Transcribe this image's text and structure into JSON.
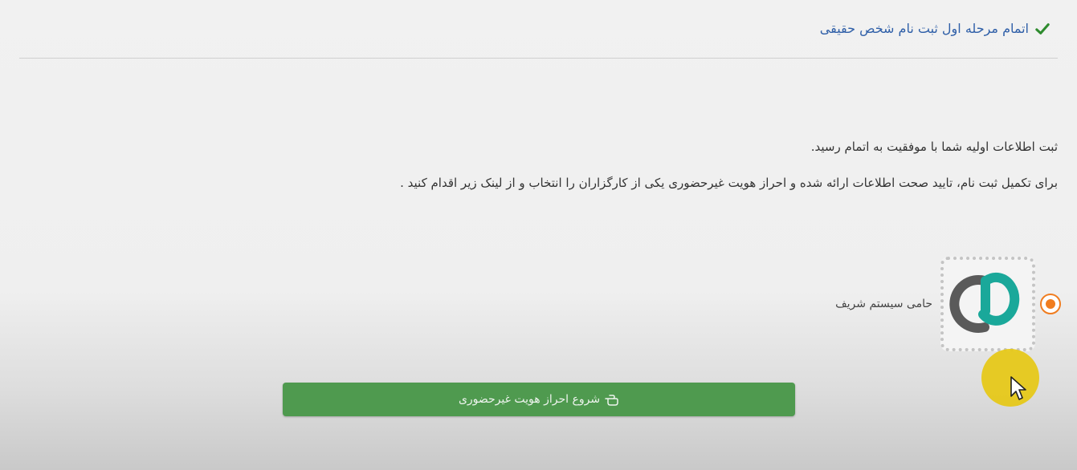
{
  "header": {
    "title": "اتمام مرحله اول ثبت نام شخص حقیقی",
    "icon": "check-icon",
    "color": "#2f5fa8"
  },
  "messages": {
    "success": "ثبت اطلاعات اولیه شما با موفقیت به اتمام رسید.",
    "instruction": "برای تکمیل ثبت نام، تایید صحت اطلاعات ارائه شده و احراز هویت غیرحضوری یکی از کارگزاران را انتخاب و از لینک زیر اقدام کنید ."
  },
  "provider": {
    "label": "حامی سیستم شریف",
    "selected": true,
    "accent": "#f07d20"
  },
  "actions": {
    "start_label": "شروع احراز هویت غیرحضوری",
    "icon": "hand-pointer-icon",
    "color": "#4f9a4f"
  }
}
